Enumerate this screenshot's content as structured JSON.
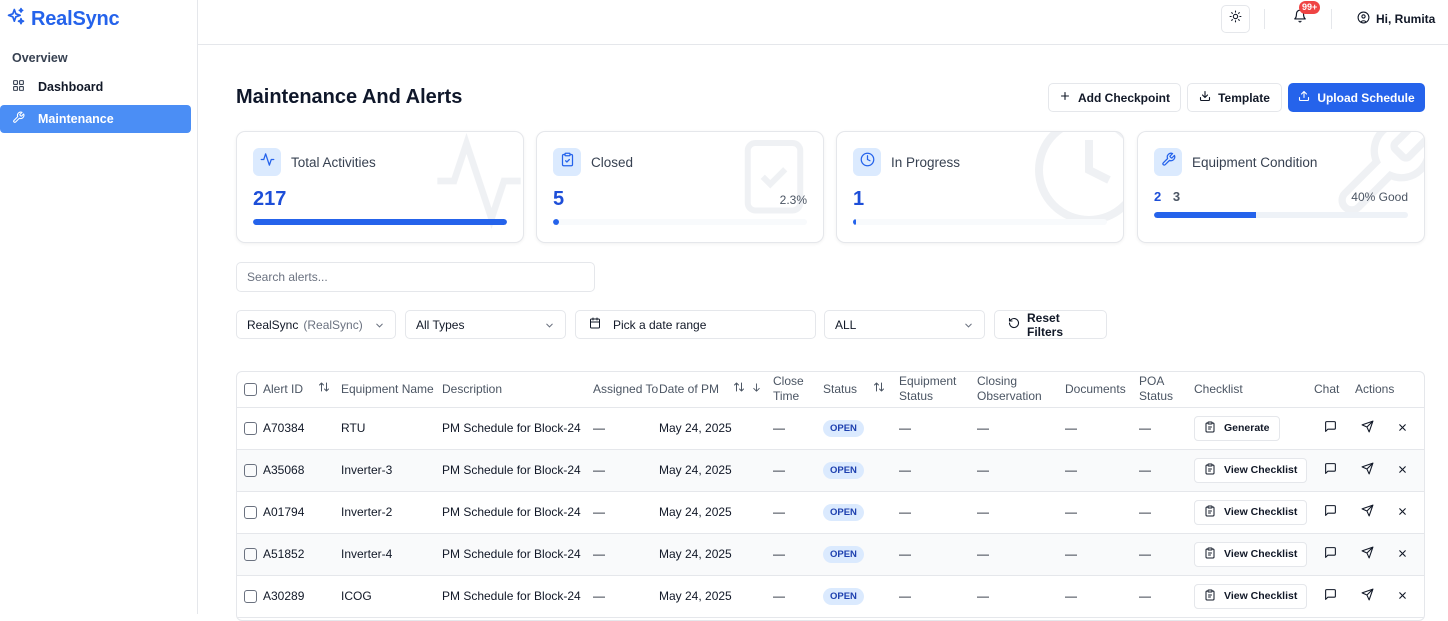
{
  "app": {
    "name": "RealSync"
  },
  "sidebar": {
    "section": "Overview",
    "items": [
      {
        "label": "Dashboard",
        "icon": "grid-icon",
        "active": false
      },
      {
        "label": "Maintenance",
        "icon": "wrench-icon",
        "active": true
      }
    ]
  },
  "topbar": {
    "notification_count": "99+",
    "greeting": "Hi, Rumita"
  },
  "page": {
    "title": "Maintenance And Alerts",
    "buttons": {
      "add_checkpoint": "Add Checkpoint",
      "template": "Template",
      "upload_schedule": "Upload Schedule"
    }
  },
  "cards": {
    "total": {
      "title": "Total Activities",
      "value": "217",
      "progress": 1.0
    },
    "closed": {
      "title": "Closed",
      "value": "5",
      "percent": "2.3%",
      "progress": 0.023
    },
    "in_progress": {
      "title": "In Progress",
      "value": "1",
      "progress": 0.005
    },
    "equipment": {
      "title": "Equipment Condition",
      "value_a": "2",
      "value_b": "3",
      "percent": "40% Good",
      "progress": 0.4
    }
  },
  "search": {
    "placeholder": "Search alerts..."
  },
  "filters": {
    "site": "RealSync",
    "site_sub": "(RealSync)",
    "type": "All Types",
    "date": "Pick a date range",
    "status": "ALL",
    "reset": "Reset Filters"
  },
  "table": {
    "headers": {
      "alert_id": "Alert ID",
      "equipment_name": "Equipment Name",
      "description": "Description",
      "assigned_to": "Assigned To",
      "date_of_pm": "Date of PM",
      "close_time": "Close Time",
      "status": "Status",
      "equipment_status": "Equipment Status",
      "closing_observation": "Closing Observation",
      "documents": "Documents",
      "poa_status": "POA Status",
      "checklist": "Checklist",
      "chat": "Chat",
      "actions": "Actions"
    },
    "rows": [
      {
        "id": "A70384",
        "equipment": "RTU",
        "description": "PM Schedule for Block-24",
        "assigned": "—",
        "date": "May 24, 2025",
        "close": "—",
        "status": "OPEN",
        "eq_status": "—",
        "observation": "—",
        "documents": "—",
        "poa": "—",
        "checklist": "Generate"
      },
      {
        "id": "A35068",
        "equipment": "Inverter-3",
        "description": "PM Schedule for Block-24",
        "assigned": "—",
        "date": "May 24, 2025",
        "close": "—",
        "status": "OPEN",
        "eq_status": "—",
        "observation": "—",
        "documents": "—",
        "poa": "—",
        "checklist": "View Checklist"
      },
      {
        "id": "A01794",
        "equipment": "Inverter-2",
        "description": "PM Schedule for Block-24",
        "assigned": "—",
        "date": "May 24, 2025",
        "close": "—",
        "status": "OPEN",
        "eq_status": "—",
        "observation": "—",
        "documents": "—",
        "poa": "—",
        "checklist": "View Checklist"
      },
      {
        "id": "A51852",
        "equipment": "Inverter-4",
        "description": "PM Schedule for Block-24",
        "assigned": "—",
        "date": "May 24, 2025",
        "close": "—",
        "status": "OPEN",
        "eq_status": "—",
        "observation": "—",
        "documents": "—",
        "poa": "—",
        "checklist": "View Checklist"
      },
      {
        "id": "A30289",
        "equipment": "ICOG",
        "description": "PM Schedule for Block-24",
        "assigned": "—",
        "date": "May 24, 2025",
        "close": "—",
        "status": "OPEN",
        "eq_status": "—",
        "observation": "—",
        "documents": "—",
        "poa": "—",
        "checklist": "View Checklist"
      }
    ]
  },
  "colors": {
    "accent": "#2563eb",
    "sidebar_active": "#4b8ef5",
    "badge": "#ef4444"
  }
}
